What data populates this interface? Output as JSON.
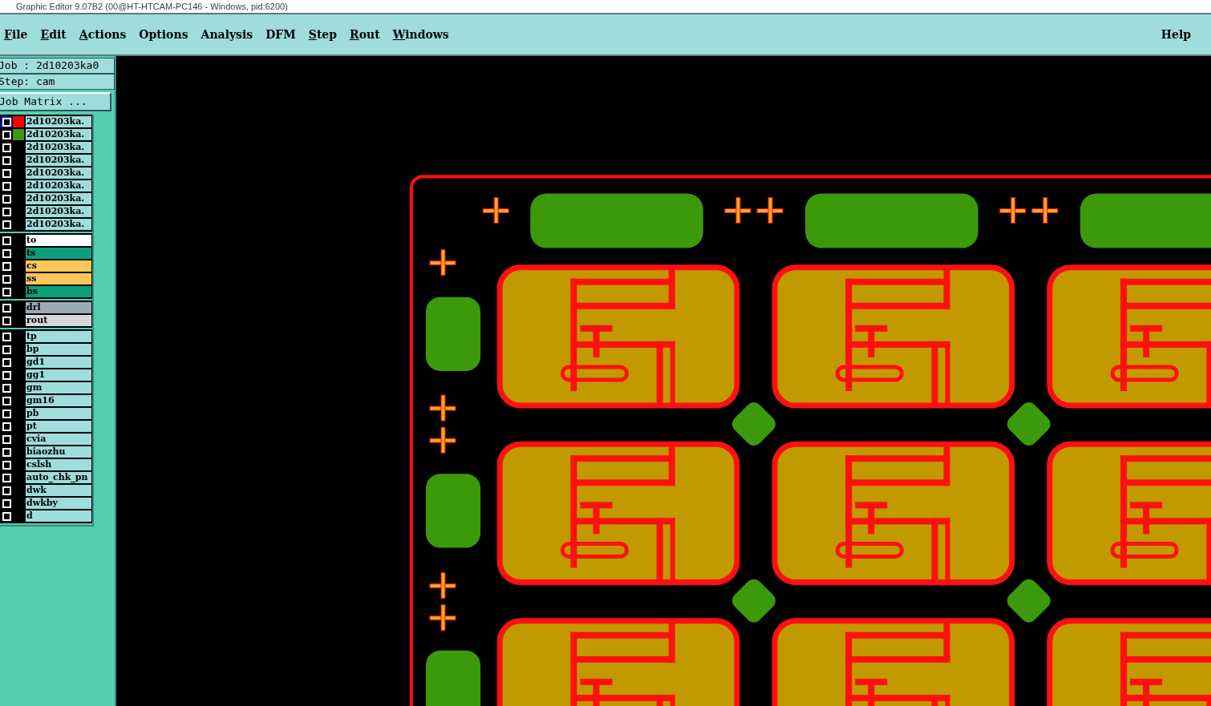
{
  "window": {
    "title": "Graphic Editor 9.07B2 (00@HT-HTCAM-PC146 - Windows, pid:6200)"
  },
  "menu": [
    {
      "label": "File",
      "mnemonic": true
    },
    {
      "label": "Edit",
      "mnemonic": true
    },
    {
      "label": "Actions",
      "mnemonic": true
    },
    {
      "label": "Options",
      "mnemonic": false
    },
    {
      "label": "Analysis",
      "mnemonic": false
    },
    {
      "label": "DFM",
      "mnemonic": false
    },
    {
      "label": "Step",
      "mnemonic": true
    },
    {
      "label": "Rout",
      "mnemonic": true
    },
    {
      "label": "Windows",
      "mnemonic": true
    }
  ],
  "help": "Help",
  "job": "Job : 2d10203ka0",
  "step": "Step: cam",
  "job_matrix": "Job Matrix ...",
  "layer_groups": [
    [
      {
        "name": "2d10203ka.",
        "color": "#9fdcdc",
        "swatch": {
          "color": "#ff0000"
        },
        "selected": true,
        "checked": false
      },
      {
        "name": "2d10203ka.",
        "color": "#9fdcdc",
        "swatch": {
          "color": "#3c9a0a"
        },
        "selected": false,
        "checked": false
      },
      {
        "name": "2d10203ka.",
        "color": "#9fdcdc",
        "selected": false,
        "checked": false
      },
      {
        "name": "2d10203ka.",
        "color": "#9fdcdc",
        "selected": false,
        "checked": false
      },
      {
        "name": "2d10203ka.",
        "color": "#9fdcdc",
        "selected": false,
        "checked": false
      },
      {
        "name": "2d10203ka.",
        "color": "#9fdcdc",
        "selected": false,
        "checked": false
      },
      {
        "name": "2d10203ka.",
        "color": "#9fdcdc",
        "selected": false,
        "checked": false
      },
      {
        "name": "2d10203ka.",
        "color": "#9fdcdc",
        "selected": false,
        "checked": false
      },
      {
        "name": "2d10203ka.",
        "color": "#9fdcdc",
        "selected": false,
        "checked": false
      }
    ],
    [
      {
        "name": "to",
        "color": "#ffffff",
        "selected": false,
        "checked": false
      },
      {
        "name": "ts",
        "color": "#0aa07a",
        "selected": false,
        "checked": false
      },
      {
        "name": "cs",
        "color": "#fdc65a",
        "selected": false,
        "checked": false
      },
      {
        "name": "ss",
        "color": "#fdc65a",
        "selected": false,
        "checked": false
      },
      {
        "name": "bs",
        "color": "#0aa07a",
        "selected": false,
        "checked": false
      }
    ],
    [
      {
        "name": "drl",
        "color": "#9aaab4",
        "selected": false,
        "checked": false
      },
      {
        "name": "rout",
        "color": "#d8d8d8",
        "selected": false,
        "checked": false
      }
    ],
    [
      {
        "name": "tp",
        "color": "#9fdcdc",
        "selected": false,
        "checked": false
      },
      {
        "name": "bp",
        "color": "#9fdcdc",
        "selected": false,
        "checked": false
      },
      {
        "name": "gd1",
        "color": "#9fdcdc",
        "selected": false,
        "checked": false
      },
      {
        "name": "gg1",
        "color": "#9fdcdc",
        "selected": false,
        "checked": false
      },
      {
        "name": "gm",
        "color": "#9fdcdc",
        "selected": false,
        "checked": false
      },
      {
        "name": "gm16",
        "color": "#9fdcdc",
        "selected": false,
        "checked": false
      },
      {
        "name": "pb",
        "color": "#9fdcdc",
        "selected": false,
        "checked": false
      },
      {
        "name": "pt",
        "color": "#9fdcdc",
        "selected": false,
        "checked": false
      },
      {
        "name": "cvia",
        "color": "#9fdcdc",
        "selected": false,
        "checked": false
      },
      {
        "name": "biaozhu",
        "color": "#9fdcdc",
        "selected": false,
        "checked": false
      },
      {
        "name": "cslsh",
        "color": "#9fdcdc",
        "selected": false,
        "checked": false
      },
      {
        "name": "auto_chk_pn",
        "color": "#9fdcdc",
        "selected": false,
        "checked": false
      },
      {
        "name": "dwk",
        "color": "#9fdcdc",
        "selected": false,
        "checked": false
      },
      {
        "name": "dwkby",
        "color": "#9fdcdc",
        "selected": false,
        "checked": false
      },
      {
        "name": "d",
        "color": "#9fdcdc",
        "selected": false,
        "checked": false
      }
    ]
  ]
}
